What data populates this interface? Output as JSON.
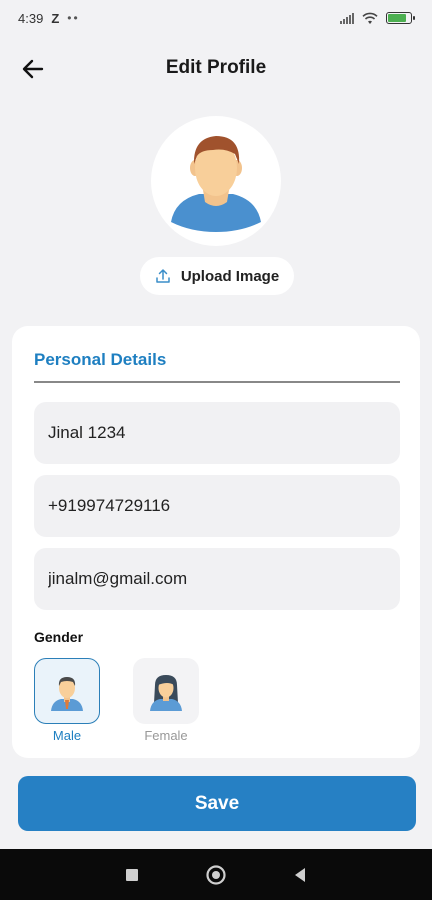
{
  "status_bar": {
    "time": "4:39",
    "carrier_icon": "Z",
    "dots": "••"
  },
  "header": {
    "title": "Edit Profile",
    "back_icon": "arrow-left-icon"
  },
  "avatar": {
    "icon": "male-avatar-icon"
  },
  "upload": {
    "label": "Upload Image",
    "icon": "upload-icon"
  },
  "personal_details": {
    "title": "Personal Details",
    "name_value": "Jinal 1234",
    "phone_value": "+919974729116",
    "email_value": "jinalm@gmail.com"
  },
  "gender": {
    "label": "Gender",
    "selected": "Male",
    "options": [
      {
        "label": "Male",
        "icon": "male-avatar-icon"
      },
      {
        "label": "Female",
        "icon": "female-avatar-icon"
      }
    ]
  },
  "save": {
    "label": "Save"
  },
  "colors": {
    "accent": "#2680c4",
    "section_title": "#1e7fc1",
    "background": "#f2f2f4"
  }
}
